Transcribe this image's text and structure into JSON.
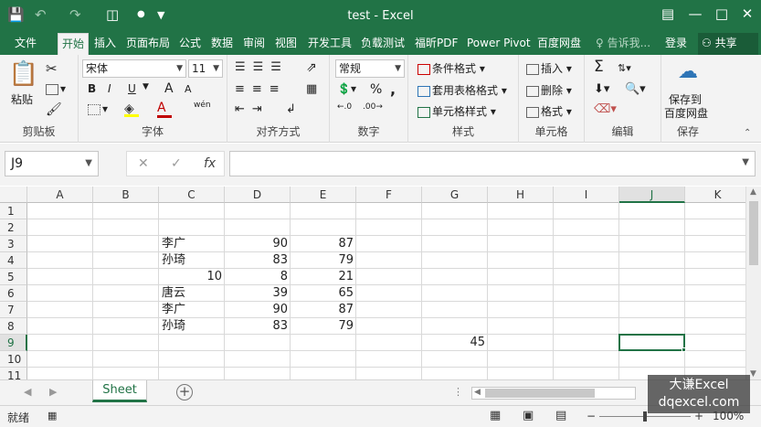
{
  "app": {
    "title": "test - Excel",
    "quick_access": [
      "save",
      "undo",
      "redo",
      "camera",
      "more"
    ],
    "window_controls": [
      "restore-ribbon",
      "minimize",
      "maximize",
      "close"
    ]
  },
  "ribbon_tabs": [
    "文件",
    "开始",
    "插入",
    "页面布局",
    "公式",
    "数据",
    "审阅",
    "视图",
    "开发工具",
    "负载测试",
    "福昕PDF",
    "Power Pivot",
    "百度网盘"
  ],
  "active_tab": "开始",
  "tell_me": "♀ 告诉我...",
  "login": "登录",
  "share": "共享",
  "ribbon": {
    "clipboard": {
      "label": "剪贴板",
      "paste": "粘贴"
    },
    "font": {
      "label": "字体",
      "name": "宋体",
      "size": "11",
      "bold": "B",
      "italic": "I",
      "underline": "U",
      "grow": "A",
      "shrink": "A",
      "phonetic": "wén",
      "font_color_sample": "A"
    },
    "align": {
      "label": "对齐方式"
    },
    "number": {
      "label": "数字",
      "format": "常规",
      "percent": "%",
      "comma": ","
    },
    "styles": {
      "label": "样式",
      "cond_format": "条件格式",
      "table_format": "套用表格格式",
      "cell_styles": "单元格样式"
    },
    "cells": {
      "label": "单元格",
      "insert": "插入",
      "delete": "删除",
      "format": "格式"
    },
    "edit": {
      "label": "编辑",
      "sigma": "Σ"
    },
    "save": {
      "label": "保存",
      "save_to": "保存到",
      "baidu": "百度网盘"
    }
  },
  "formula_bar": {
    "name_box": "J9",
    "cancel": "✕",
    "enter": "✓",
    "fx": "fx",
    "content": ""
  },
  "columns": [
    "A",
    "B",
    "C",
    "D",
    "E",
    "F",
    "G",
    "H",
    "I",
    "J",
    "K"
  ],
  "rows": [
    "1",
    "2",
    "3",
    "4",
    "5",
    "6",
    "7",
    "8",
    "9",
    "10",
    "11"
  ],
  "selected_cell": {
    "column": "J",
    "row": "9"
  },
  "cells": {
    "C3": "李广",
    "D3": "90",
    "E3": "87",
    "C4": "孙琦",
    "D4": "83",
    "E4": "79",
    "C5": "10",
    "D5": "8",
    "E5": "21",
    "C6": "唐云",
    "D6": "39",
    "E6": "65",
    "C7": "李广",
    "D7": "90",
    "E7": "87",
    "C8": "孙琦",
    "D8": "83",
    "E8": "79",
    "G9": "45"
  },
  "sheets": [
    "Sheet"
  ],
  "active_sheet": "Sheet",
  "status": {
    "mode": "就绪",
    "zoom": "100%"
  },
  "watermark": {
    "line1": "大谦Excel",
    "line2": "dqexcel.com"
  },
  "colors": {
    "brand": "#217346",
    "ribbon_bg": "#f3f3f3",
    "grid_line": "#d9d9d9"
  }
}
